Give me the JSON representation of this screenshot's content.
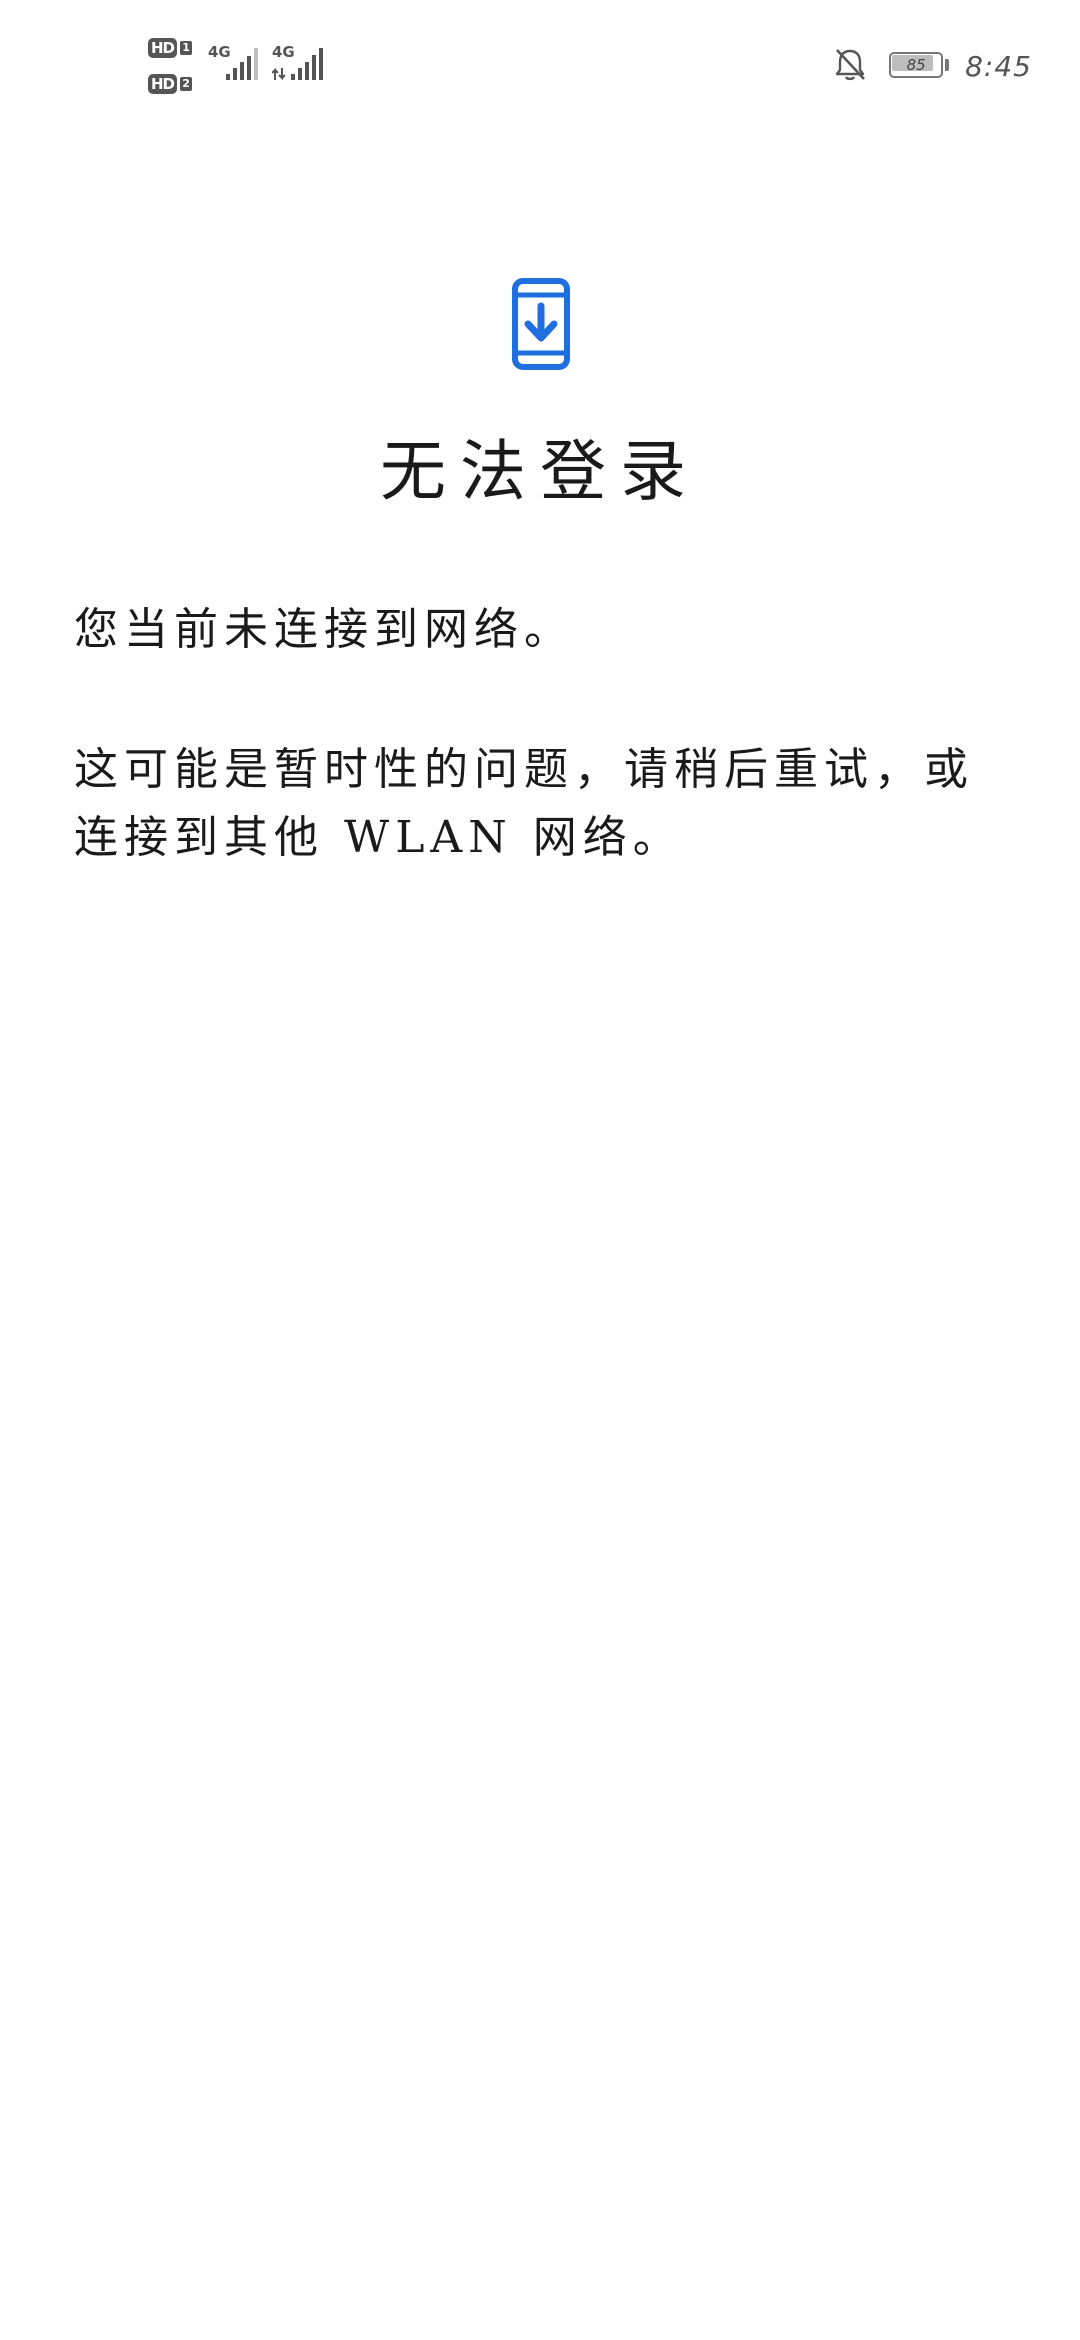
{
  "status_bar": {
    "sim1_badge": "HD",
    "sim1_index": "1",
    "sim2_badge": "HD",
    "sim2_index": "2",
    "network1_label": "4G",
    "network2_label": "4G",
    "battery_level": "85",
    "time": "8:45",
    "icons": [
      "signal-bars-icon",
      "data-activity-icon",
      "notifications-off-icon",
      "battery-icon"
    ]
  },
  "main": {
    "icon": "phone-download-icon",
    "title": "无法登录",
    "message_1": "您当前未连接到网络。",
    "message_2": "这可能是暂时性的问题，请稍后重试，或连接到其他 WLAN 网络。"
  },
  "colors": {
    "accent": "#1f6fde",
    "text": "#1a1a1a",
    "status_icons": "#555555",
    "background": "#ffffff"
  }
}
